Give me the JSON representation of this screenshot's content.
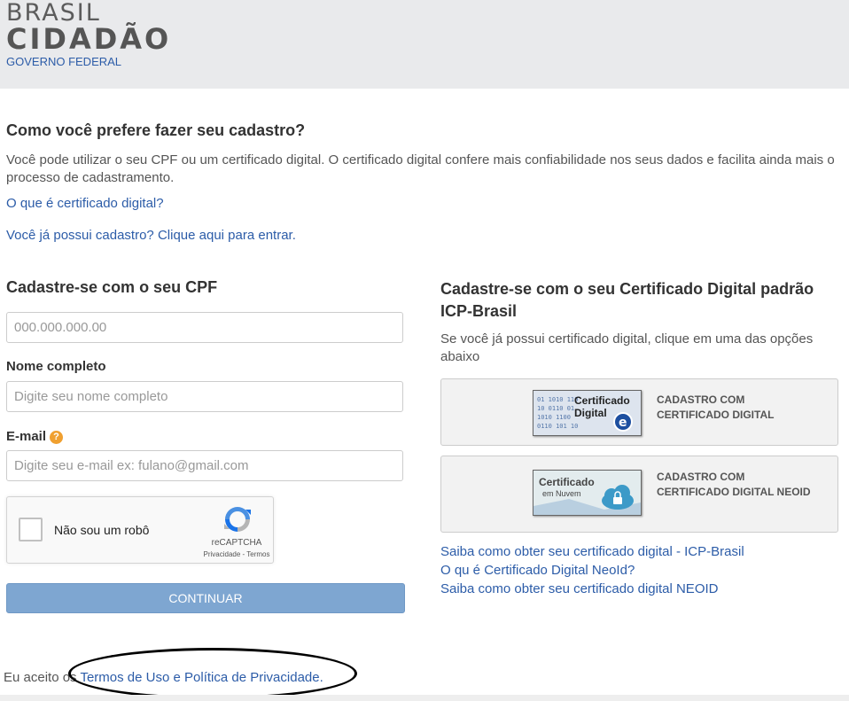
{
  "header": {
    "logo_line1": "BRASIL",
    "logo_line2": "CIDADÃO",
    "logo_line3": "GOVERNO FEDERAL"
  },
  "intro": {
    "title": "Como você prefere fazer seu cadastro?",
    "text": "Você pode utilizar o seu CPF ou um certificado digital. O certificado digital confere mais confiabilidade nos seus dados e facilita ainda mais o processo de cadastramento.",
    "link_what_is_cert": "O que é certificado digital?",
    "link_already_registered": "Você já possui cadastro? Clique aqui para entrar."
  },
  "cpf_form": {
    "title": "Cadastre-se com o seu CPF",
    "cpf_placeholder": "000.000.000.00",
    "name_label": "Nome completo",
    "name_placeholder": "Digite seu nome completo",
    "email_label": "E-mail",
    "email_help_icon": "question-circle-icon",
    "email_placeholder": "Digite seu e-mail ex: fulano@gmail.com",
    "captcha": {
      "label": "Não sou um robô",
      "brand": "reCAPTCHA",
      "terms": "Privacidade - Termos"
    },
    "continue_label": "CONTINUAR"
  },
  "certificate": {
    "title": "Cadastre-se com o seu Certificado Digital padrão ICP-Brasil",
    "description": "Se você já possui certificado digital, clique em uma das opções abaixo",
    "option1": {
      "image_text_line1": "Certificado",
      "image_text_line2": "Digital",
      "label": "CADASTRO COM CERTIFICADO DIGITAL"
    },
    "option2": {
      "image_text_line1": "Certificado",
      "image_text_line2": "em Nuvem",
      "label": "CADASTRO COM CERTIFICADO DIGITAL NEOID"
    },
    "links": [
      "Saiba como obter seu certificado digital - ICP-Brasil",
      "O qu é Certificado Digital NeoId?",
      "Saiba como obter seu certificado digital NEOID"
    ]
  },
  "footer": {
    "prefix": "Eu aceito os",
    "link": "Termos de Uso e Política de Privacidade."
  },
  "colors": {
    "link": "#2c5ca8",
    "header_bg": "#e9eaec",
    "continue_button": "#7ea6d1",
    "help_icon": "#f0a030"
  }
}
